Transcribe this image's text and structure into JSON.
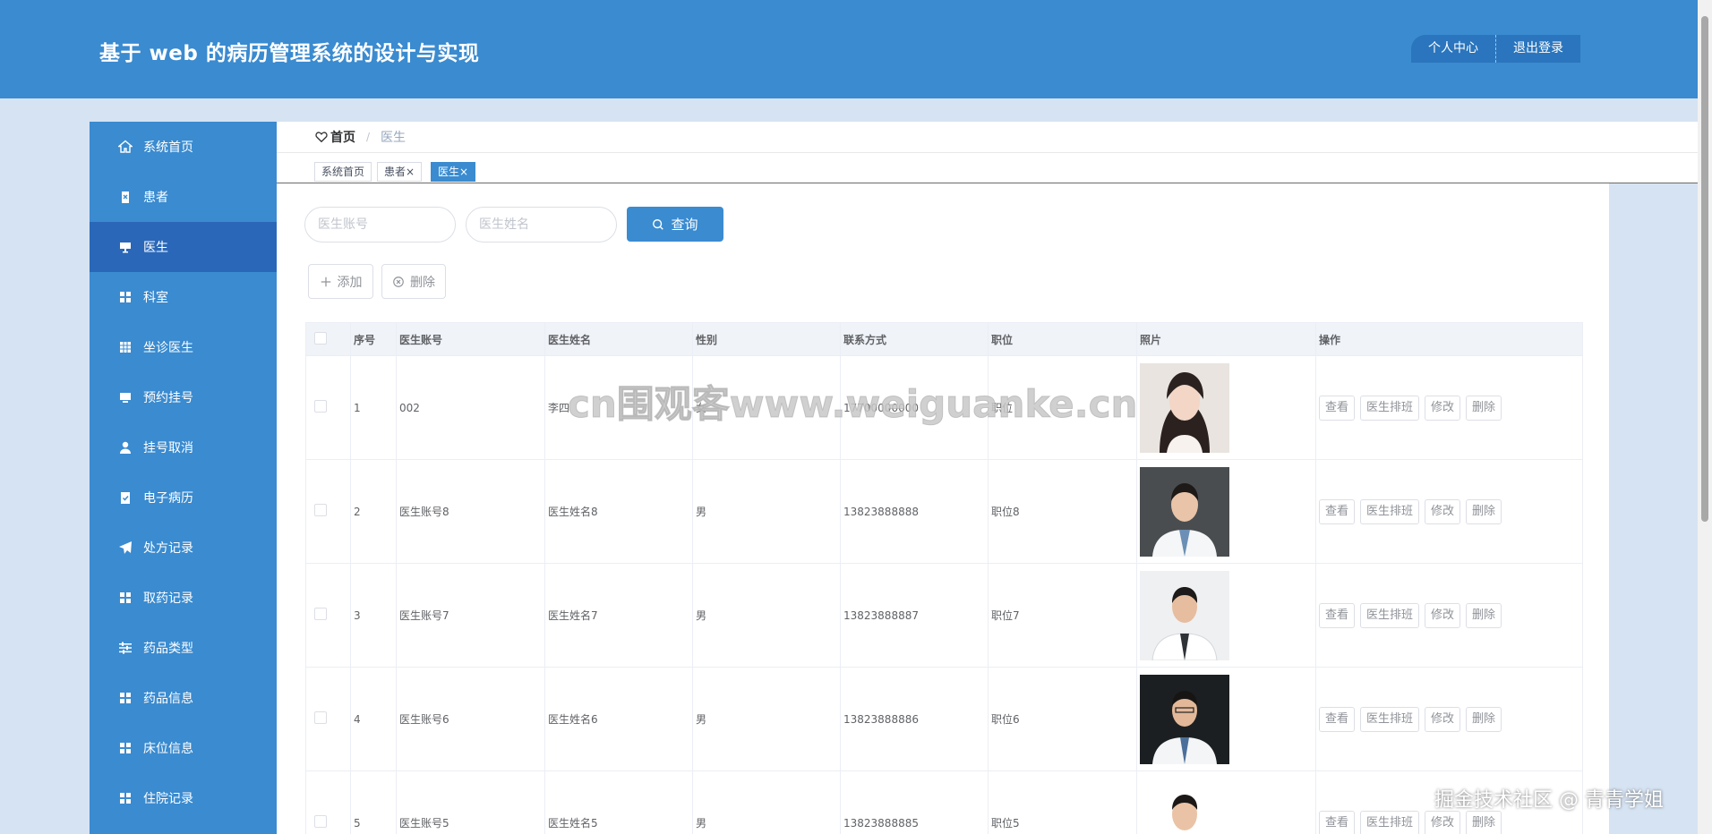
{
  "header": {
    "title": "基于 web 的病历管理系统的设计与实现",
    "personal_center": "个人中心",
    "logout": "退出登录"
  },
  "sidebar": {
    "items": [
      {
        "label": "系统首页",
        "icon": "home-icon"
      },
      {
        "label": "患者",
        "icon": "clipboard-icon"
      },
      {
        "label": "医生",
        "icon": "monitor-icon",
        "active": true
      },
      {
        "label": "科室",
        "icon": "grid-icon"
      },
      {
        "label": "坐诊医生",
        "icon": "table-icon"
      },
      {
        "label": "预约挂号",
        "icon": "monitor-icon"
      },
      {
        "label": "挂号取消",
        "icon": "user-icon"
      },
      {
        "label": "电子病历",
        "icon": "clipboard-check-icon"
      },
      {
        "label": "处方记录",
        "icon": "send-icon"
      },
      {
        "label": "取药记录",
        "icon": "grid-icon"
      },
      {
        "label": "药品类型",
        "icon": "sliders-icon"
      },
      {
        "label": "药品信息",
        "icon": "grid-icon"
      },
      {
        "label": "床位信息",
        "icon": "grid-icon"
      },
      {
        "label": "住院记录",
        "icon": "grid-icon"
      }
    ]
  },
  "breadcrumb": {
    "home": "首页",
    "separator": "/",
    "current": "医生"
  },
  "tabs": [
    {
      "label": "系统首页"
    },
    {
      "label": "患者",
      "close": "×"
    },
    {
      "label": "医生",
      "close": "×",
      "active": true
    }
  ],
  "search": {
    "account_placeholder": "医生账号",
    "name_placeholder": "医生姓名",
    "query_label": "查询"
  },
  "actions": {
    "add_label": "添加",
    "delete_label": "删除"
  },
  "table": {
    "columns": [
      "",
      "序号",
      "医生账号",
      "医生姓名",
      "性别",
      "联系方式",
      "职位",
      "照片",
      "操作"
    ],
    "row_buttons": [
      "查看",
      "医生排班",
      "修改",
      "删除"
    ],
    "rows": [
      {
        "no": "1",
        "account": "002",
        "name": "李四",
        "gender": "女",
        "phone": "17700000000",
        "position": "职位",
        "photo": "female-portrait"
      },
      {
        "no": "2",
        "account": "医生账号8",
        "name": "医生姓名8",
        "gender": "男",
        "phone": "13823888888",
        "position": "职位8",
        "photo": "male-doctor-portrait"
      },
      {
        "no": "3",
        "account": "医生账号7",
        "name": "医生姓名7",
        "gender": "男",
        "phone": "13823888887",
        "position": "职位7",
        "photo": "male-doctor-portrait"
      },
      {
        "no": "4",
        "account": "医生账号6",
        "name": "医生姓名6",
        "gender": "男",
        "phone": "13823888886",
        "position": "职位6",
        "photo": "male-doctor-portrait"
      },
      {
        "no": "5",
        "account": "医生账号5",
        "name": "医生姓名5",
        "gender": "男",
        "phone": "13823888885",
        "position": "职位5",
        "photo": "male-doctor-portrait"
      }
    ]
  },
  "overlay": {
    "watermark": "cn围观客www.weiguanke.cn",
    "credit": "掘金技术社区 @ 青青学姐"
  },
  "colors": {
    "primary": "#3a8bd0",
    "sidebar_active": "#2a67b8",
    "page_bg": "#d6e3f2"
  }
}
